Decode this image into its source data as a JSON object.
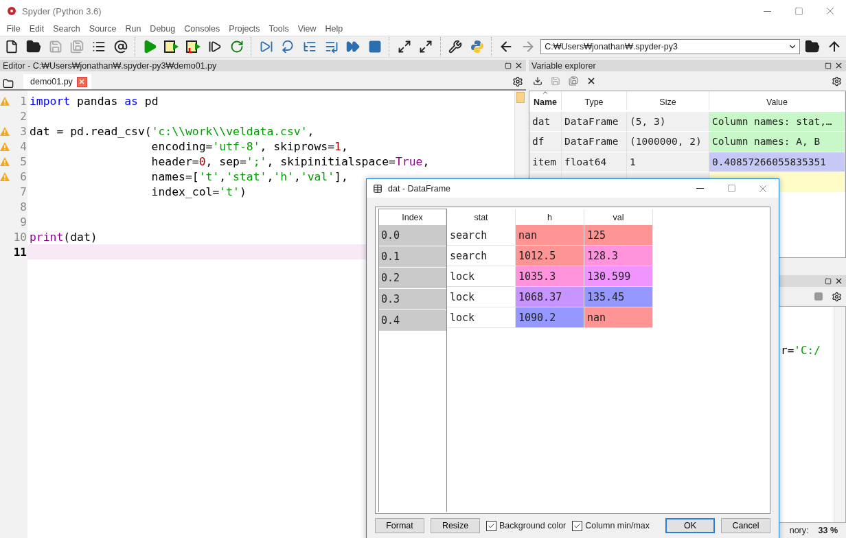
{
  "window": {
    "title": "Spyder (Python 3.6)"
  },
  "menu": [
    "File",
    "Edit",
    "Search",
    "Source",
    "Run",
    "Debug",
    "Consoles",
    "Projects",
    "Tools",
    "View",
    "Help"
  ],
  "toolbar": {
    "path": "C:₩Users₩jonathan₩.spyder-py3"
  },
  "editor": {
    "title": "Editor - C:₩Users₩jonathan₩.spyder-py3₩demo01.py",
    "tabs": [
      {
        "label": "demo01.py",
        "selected": true
      }
    ],
    "lines": [
      {
        "number": "1",
        "warning": true,
        "current": false,
        "tokens": [
          {
            "kind": "kw",
            "t": "import"
          },
          {
            "kind": "p",
            "t": " pandas "
          },
          {
            "kind": "kw",
            "t": "as"
          },
          {
            "kind": "p",
            "t": " pd"
          }
        ]
      },
      {
        "number": "2",
        "warning": false,
        "current": false
      },
      {
        "number": "3",
        "warning": true,
        "current": false,
        "tokens": [
          {
            "kind": "p",
            "t": "dat = pd.read_csv("
          },
          {
            "kind": "str",
            "t": "'c:\\\\work\\\\veldata.csv'"
          },
          {
            "kind": "p",
            "t": ","
          }
        ]
      },
      {
        "number": "4",
        "warning": true,
        "current": false,
        "tokens": [
          {
            "kind": "p",
            "t": "                  encoding="
          },
          {
            "kind": "str",
            "t": "'utf-8'"
          },
          {
            "kind": "p",
            "t": ", skiprows="
          },
          {
            "kind": "num",
            "t": "1"
          },
          {
            "kind": "p",
            "t": ","
          }
        ]
      },
      {
        "number": "5",
        "warning": true,
        "current": false,
        "tokens": [
          {
            "kind": "p",
            "t": "                  header="
          },
          {
            "kind": "num",
            "t": "0"
          },
          {
            "kind": "p",
            "t": ", sep="
          },
          {
            "kind": "str",
            "t": "';'"
          },
          {
            "kind": "p",
            "t": ", skipinitialspace="
          },
          {
            "kind": "builtin",
            "t": "True"
          },
          {
            "kind": "p",
            "t": ","
          }
        ]
      },
      {
        "number": "6",
        "warning": true,
        "current": false,
        "tokens": [
          {
            "kind": "p",
            "t": "                  names=["
          },
          {
            "kind": "str",
            "t": "'t'"
          },
          {
            "kind": "p",
            "t": ","
          },
          {
            "kind": "str",
            "t": "'stat'"
          },
          {
            "kind": "p",
            "t": ","
          },
          {
            "kind": "str",
            "t": "'h'"
          },
          {
            "kind": "p",
            "t": ","
          },
          {
            "kind": "str",
            "t": "'val'"
          },
          {
            "kind": "p",
            "t": "],"
          }
        ]
      },
      {
        "number": "7",
        "warning": false,
        "current": false,
        "tokens": [
          {
            "kind": "p",
            "t": "                  index_col="
          },
          {
            "kind": "str",
            "t": "'t'"
          },
          {
            "kind": "p",
            "t": ")"
          }
        ]
      },
      {
        "number": "8",
        "warning": false,
        "current": false
      },
      {
        "number": "9",
        "warning": false,
        "current": false
      },
      {
        "number": "10",
        "warning": false,
        "current": false,
        "tokens": [
          {
            "kind": "builtin",
            "t": "print"
          },
          {
            "kind": "p",
            "t": "(dat)"
          }
        ]
      },
      {
        "number": "11",
        "warning": false,
        "current": true
      }
    ]
  },
  "variable_explorer": {
    "title": "Variable explorer",
    "columns": [
      {
        "label": "Name",
        "sorted": true
      },
      {
        "label": "Type",
        "sorted": false
      },
      {
        "label": "Size",
        "sorted": false
      },
      {
        "label": "Value",
        "sorted": false
      }
    ],
    "rows": [
      {
        "name": "dat",
        "type": "DataFrame",
        "size": "(5, 3)",
        "value": "Column names: stat,…",
        "color": "#c8f7c8"
      },
      {
        "name": "df",
        "type": "DataFrame",
        "size": "(1000000, 2)",
        "value": "Column names: A, B",
        "color": "#c8f7c8"
      },
      {
        "name": "item",
        "type": "float64",
        "size": "1",
        "value": "0.40857266055835351",
        "color": "#c8c8f7"
      },
      {
        "color": "#fffcc8"
      }
    ]
  },
  "console": {
    "lines": [
      {
        "tokens": [
          {
            "kind": "p",
            "t": "r="
          },
          {
            "kind": "str",
            "t": "'C:/"
          }
        ]
      }
    ]
  },
  "status_bar": {
    "memory_label": "nory:",
    "memory_value": "33 %"
  },
  "dialog": {
    "title": "dat - DataFrame",
    "index_header": "Index",
    "columns": [
      "stat",
      "h",
      "val"
    ],
    "rows": [
      {
        "index": "0.0",
        "cells": [
          {
            "text": "search"
          },
          {
            "text": "nan",
            "color": "#ff9494"
          },
          {
            "text": "125",
            "color": "#ff9494"
          }
        ]
      },
      {
        "index": "0.1",
        "cells": [
          {
            "text": "search"
          },
          {
            "text": "1012.5",
            "color": "#ff9494"
          },
          {
            "text": "128.3",
            "color": "#ff94dc"
          }
        ]
      },
      {
        "index": "0.2",
        "cells": [
          {
            "text": "lock"
          },
          {
            "text": "1035.3",
            "color": "#ff94dc"
          },
          {
            "text": "130.599",
            "color": "#f094ff"
          }
        ]
      },
      {
        "index": "0.3",
        "cells": [
          {
            "text": "lock"
          },
          {
            "text": "1068.37",
            "color": "#c894ff"
          },
          {
            "text": "135.45",
            "color": "#9498ff"
          }
        ]
      },
      {
        "index": "0.4",
        "cells": [
          {
            "text": "lock"
          },
          {
            "text": "1090.2",
            "color": "#9498ff"
          },
          {
            "text": "nan",
            "color": "#ff9494"
          }
        ]
      }
    ],
    "left_buttons": [
      "Format",
      "Resize"
    ],
    "options": [
      {
        "label": "Background color",
        "checked": true
      },
      {
        "label": "Column min/max",
        "checked": true
      }
    ],
    "right_buttons": [
      {
        "label": "OK",
        "default": true
      },
      {
        "label": "Cancel",
        "default": false
      }
    ]
  }
}
